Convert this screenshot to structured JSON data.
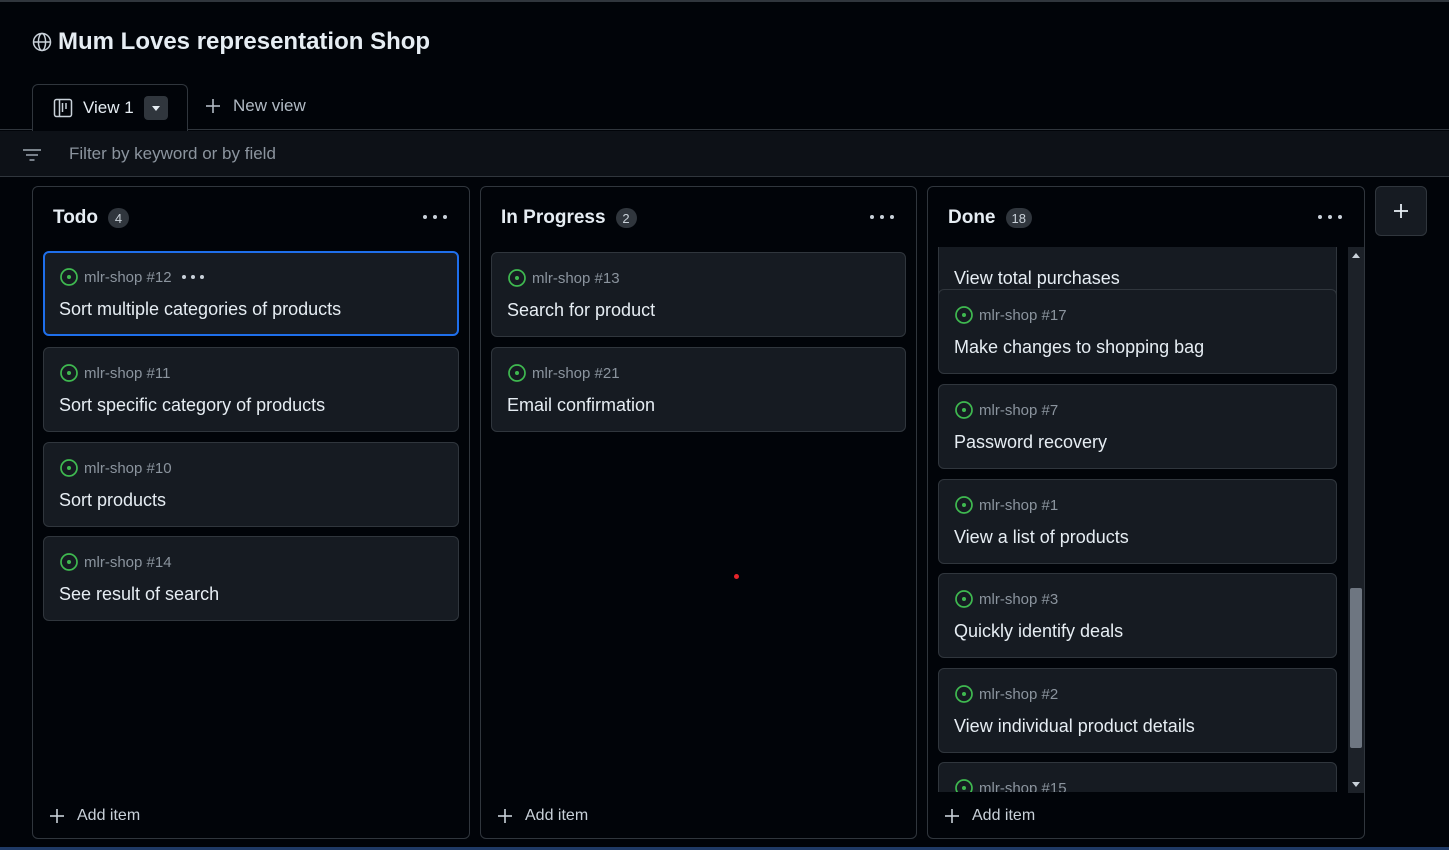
{
  "project": {
    "title": "Mum Loves representation Shop",
    "icon": "globe-icon"
  },
  "tabs": {
    "active_label": "View 1",
    "active_icon": "board-icon",
    "new_view_label": "New view"
  },
  "filter": {
    "placeholder": "Filter by keyword or by field"
  },
  "colors": {
    "accent": "#1f6feb",
    "status_open": "#3fb950",
    "background": "#010409",
    "card": "#161b22",
    "border": "#30363d"
  },
  "columns": [
    {
      "title": "Todo",
      "count": "4",
      "add_label": "Add item",
      "cards": [
        {
          "ref": "mlr-shop #12",
          "title": "Sort multiple categories of products"
        },
        {
          "ref": "mlr-shop #11",
          "title": "Sort specific category of products"
        },
        {
          "ref": "mlr-shop #10",
          "title": "Sort products"
        },
        {
          "ref": "mlr-shop #14",
          "title": "See result of search"
        }
      ]
    },
    {
      "title": "In Progress",
      "count": "2",
      "add_label": "Add item",
      "cards": [
        {
          "ref": "mlr-shop #13",
          "title": "Search for product"
        },
        {
          "ref": "mlr-shop #21",
          "title": "Email confirmation"
        }
      ]
    },
    {
      "title": "Done",
      "count": "18",
      "add_label": "Add item",
      "cards": [
        {
          "ref": "",
          "title": "View total purchases"
        },
        {
          "ref": "mlr-shop #17",
          "title": "Make changes to shopping bag"
        },
        {
          "ref": "mlr-shop #7",
          "title": "Password recovery"
        },
        {
          "ref": "mlr-shop #1",
          "title": "View a list of products"
        },
        {
          "ref": "mlr-shop #3",
          "title": "Quickly identify deals"
        },
        {
          "ref": "mlr-shop #2",
          "title": "View individual product details"
        },
        {
          "ref": "mlr-shop #15",
          "title": ""
        }
      ]
    }
  ]
}
